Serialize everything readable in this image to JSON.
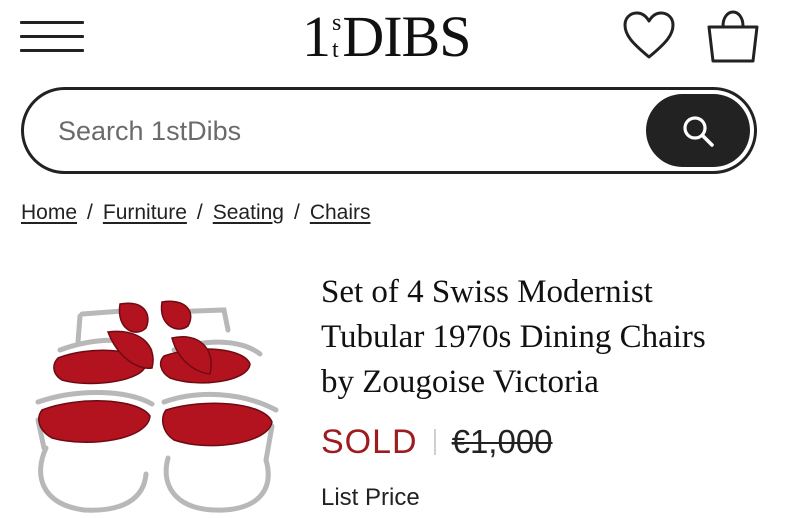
{
  "header": {
    "menu_icon": "hamburger-menu-icon",
    "logo": {
      "one": "1",
      "st_top": "s",
      "st_bottom": "t",
      "dibs": "DIBS"
    },
    "favorites_icon": "heart-icon",
    "cart_icon": "shopping-bag-icon"
  },
  "search": {
    "placeholder": "Search 1stDibs",
    "button_icon": "search-icon"
  },
  "breadcrumb": {
    "items": [
      "Home",
      "Furniture",
      "Seating",
      "Chairs"
    ],
    "separator": "/"
  },
  "product": {
    "title_lines": [
      "Set of 4 Swiss Modernist",
      "Tubular 1970s Dining Chairs",
      "by Zougoise Victoria"
    ],
    "status": "SOLD",
    "original_price": "€1,000",
    "price_label": "List Price"
  },
  "colors": {
    "sold": "#9e1b1f",
    "text": "#222222",
    "button": "#222222",
    "upholstery": "#b3121f",
    "chrome": "#b8b8b8"
  }
}
